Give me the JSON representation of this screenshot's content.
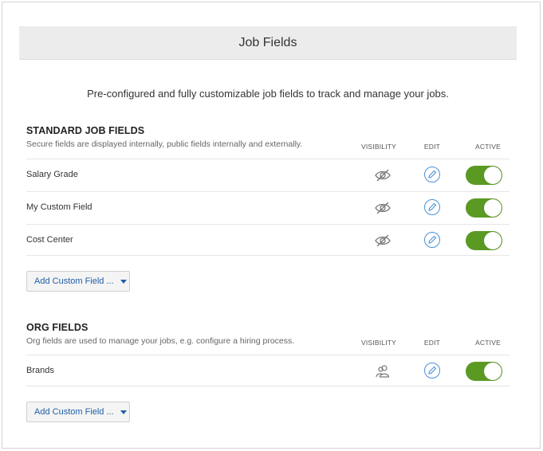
{
  "header": {
    "title": "Job Fields"
  },
  "intro": "Pre-configured and fully customizable job fields to track and manage your jobs.",
  "columns": {
    "visibility": "VISIBILITY",
    "edit": "EDIT",
    "active": "ACTIVE"
  },
  "standard": {
    "title": "STANDARD JOB FIELDS",
    "subtitle": "Secure fields are displayed internally, public fields internally and externally.",
    "rows": [
      {
        "label": "Salary Grade",
        "visibility_icon": "eye-slash-icon",
        "active": true
      },
      {
        "label": "My Custom Field",
        "visibility_icon": "eye-slash-icon",
        "active": true
      },
      {
        "label": "Cost Center",
        "visibility_icon": "eye-slash-icon",
        "active": true
      }
    ],
    "add_button": "Add Custom Field ..."
  },
  "org": {
    "title": "ORG FIELDS",
    "subtitle": "Org fields are used to manage your jobs, e.g. configure a hiring process.",
    "rows": [
      {
        "label": "Brands",
        "visibility_icon": "users-icon",
        "active": true
      }
    ],
    "add_button": "Add Custom Field ..."
  },
  "colors": {
    "toggle_on": "#5a9a23",
    "link": "#1f5fa8",
    "edit_icon": "#4a90d9",
    "header_bg": "#ececec"
  }
}
